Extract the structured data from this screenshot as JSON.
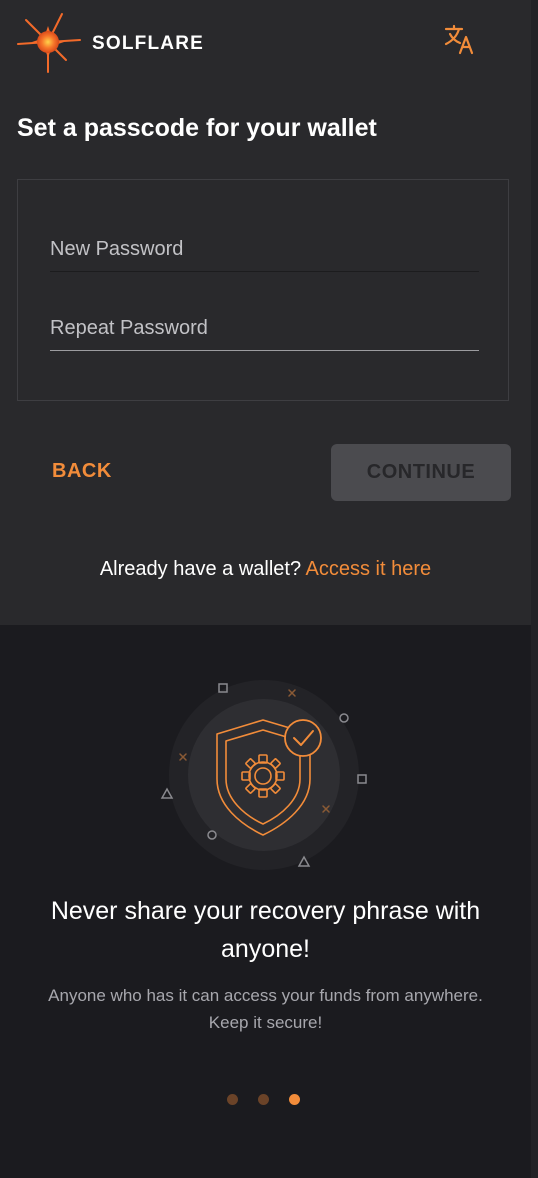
{
  "header": {
    "brand": "SOLFLARE",
    "logo_icon": "sun-flare-icon",
    "language_icon": "translate-icon"
  },
  "form": {
    "title": "Set a passcode for your wallet",
    "new_password_placeholder": "New Password",
    "repeat_password_placeholder": "Repeat Password",
    "back_label": "BACK",
    "continue_label": "CONTINUE"
  },
  "access": {
    "prefix": "Already have a wallet?",
    "link": "Access it here"
  },
  "promo": {
    "illustration_icon": "shield-gear-check-icon",
    "title": "Never share your recovery phrase with anyone!",
    "subtitle": "Anyone who has it can access your funds from anywhere. Keep it secure!"
  },
  "carousel": {
    "count": 3,
    "active_index": 2
  },
  "colors": {
    "accent": "#f28c3a",
    "top_bg": "#29292c",
    "bottom_bg": "#1b1b1f",
    "disabled_button": "#4b4b4f"
  }
}
